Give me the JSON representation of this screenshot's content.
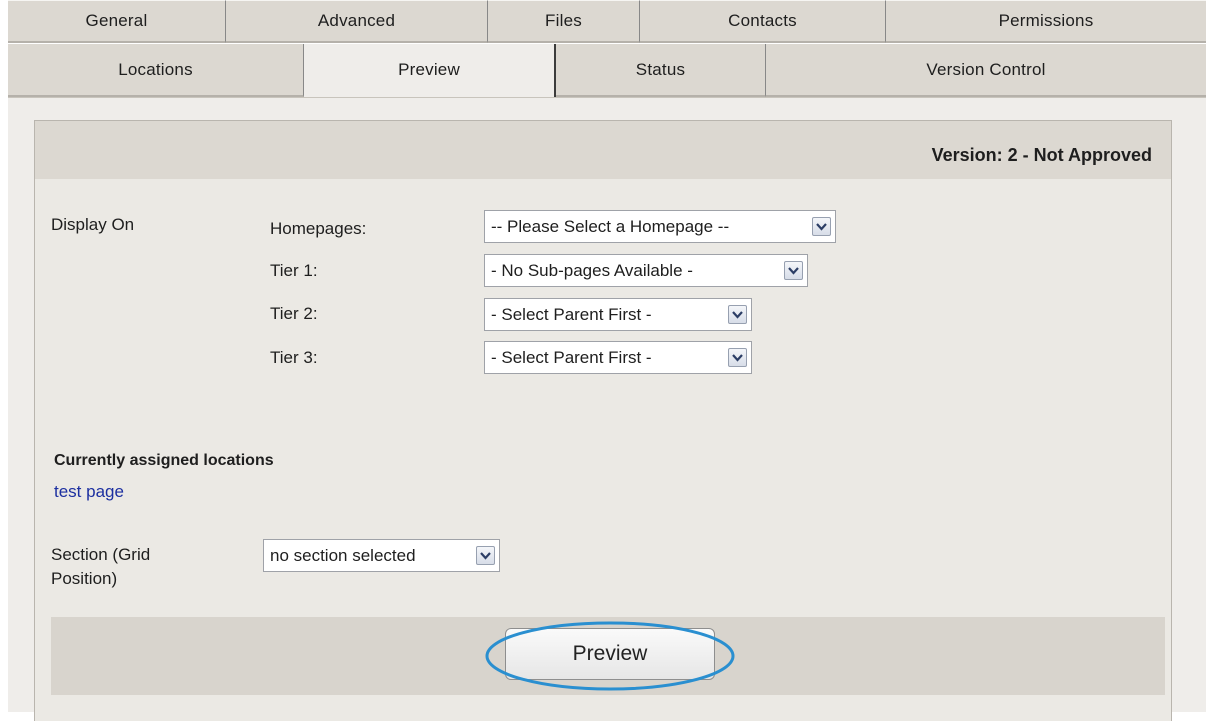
{
  "tabs_row1": [
    {
      "label": "General"
    },
    {
      "label": "Advanced"
    },
    {
      "label": "Files"
    },
    {
      "label": "Contacts"
    },
    {
      "label": "Permissions"
    }
  ],
  "tabs_row2": [
    {
      "label": "Locations"
    },
    {
      "label": "Preview",
      "active": true
    },
    {
      "label": "Status"
    },
    {
      "label": "Version Control"
    }
  ],
  "version_text": "Version: 2 - Not Approved",
  "display_on": {
    "label": "Display On",
    "homepages": {
      "label": "Homepages:",
      "value": "-- Please Select a Homepage --"
    },
    "tier1": {
      "label": "Tier 1:",
      "value": "- No Sub-pages Available -"
    },
    "tier2": {
      "label": "Tier 2:",
      "value": "- Select Parent First -"
    },
    "tier3": {
      "label": "Tier 3:",
      "value": "- Select Parent First -"
    }
  },
  "assigned": {
    "heading": "Currently assigned locations",
    "link": "test page"
  },
  "section": {
    "label_line1": "Section (Grid",
    "label_line2": "Position)",
    "value": "no section selected"
  },
  "preview_button": "Preview",
  "colors": {
    "panel_bg": "#efedea",
    "tab_bg": "#dcd8d1",
    "link": "#1c2fa0",
    "highlight_ring": "#2a8fd0"
  }
}
